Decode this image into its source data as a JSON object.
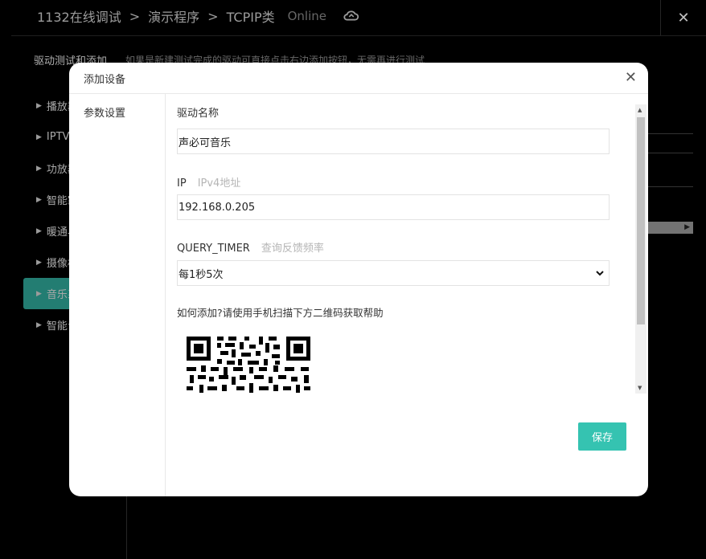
{
  "app": {
    "breadcrumb": [
      "1132在线调试",
      "演示程序",
      "TCPIP类"
    ],
    "status": "Online",
    "close_icon": "close-icon",
    "cloud_icon": "cloud-sync-icon"
  },
  "page": {
    "title": "驱动测试和添加",
    "hint": "如果是新建测试完成的驱动可直接点击右边添加按钮，无需再进行测试"
  },
  "sidebar": {
    "items": [
      {
        "label": "播放器"
      },
      {
        "label": "IPTV"
      },
      {
        "label": "功放器"
      },
      {
        "label": "智能家"
      },
      {
        "label": "暖通与"
      },
      {
        "label": "摄像机"
      },
      {
        "label": "音乐系",
        "active": true
      },
      {
        "label": "智能台"
      }
    ]
  },
  "modal": {
    "title": "添加设备",
    "nav_item": "参数设置",
    "fields": {
      "driver_name": {
        "label": "驱动名称",
        "value": "声必可音乐"
      },
      "ip": {
        "label": "IP",
        "sublabel": "IPv4地址",
        "value": "192.168.0.205"
      },
      "query_timer": {
        "label": "QUERY_TIMER",
        "sublabel": "查询反馈频率",
        "value": "每1秒5次"
      }
    },
    "help_text": "如何添加?请使用手机扫描下方二维码获取帮助",
    "save_label": "保存"
  },
  "colors": {
    "accent": "#35c3b1",
    "sidebar_active": "#2fa798",
    "background": "#000000"
  }
}
